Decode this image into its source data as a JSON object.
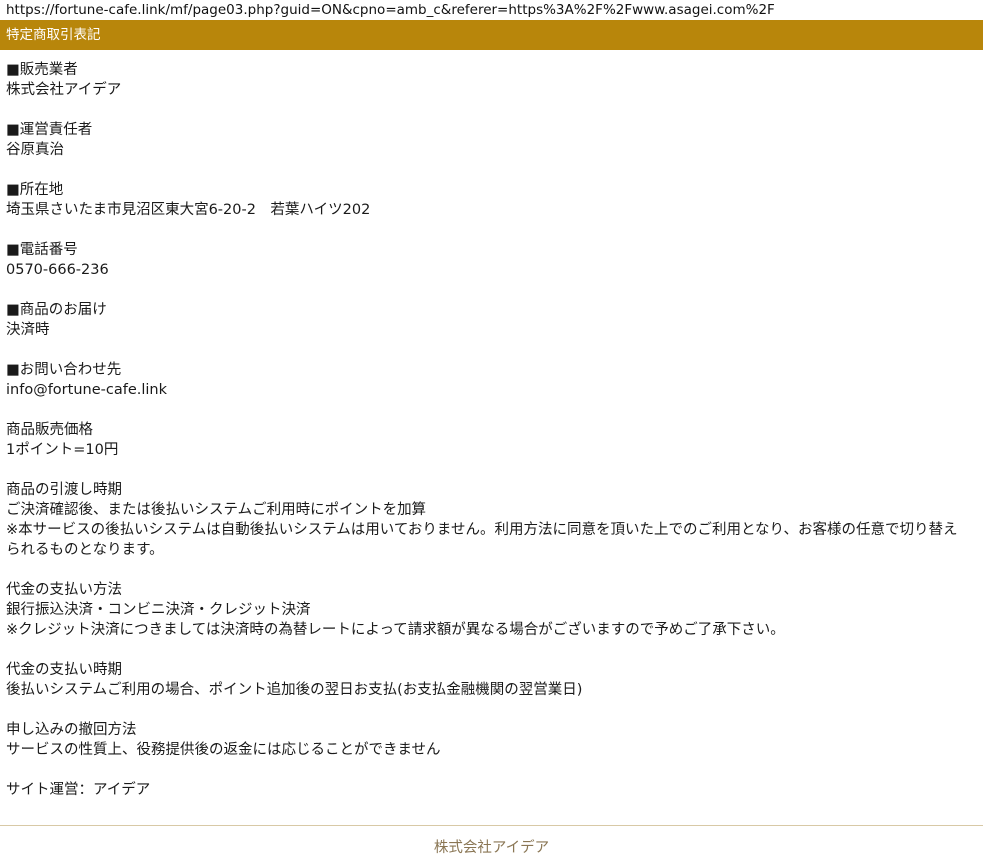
{
  "url": "https://fortune-cafe.link/mf/page03.php?guid=ON&cpno=amb_c&referer=https%3A%2F%2Fwww.asagei.com%2F",
  "header": {
    "title": "特定商取引表記"
  },
  "sections": [
    {
      "label": "■販売業者",
      "value": "株式会社アイデア"
    },
    {
      "label": "■運営責任者",
      "value": "谷原真治"
    },
    {
      "label": "■所在地",
      "value": "埼玉県さいたま市見沼区東大宮6-20-2　若葉ハイツ202"
    },
    {
      "label": "■電話番号",
      "value": "0570-666-236"
    },
    {
      "label": "■商品のお届け",
      "value": "決済時"
    },
    {
      "label": "■お問い合わせ先",
      "value": "info@fortune-cafe.link"
    },
    {
      "label": "商品販売価格",
      "value": "1ポイント=10円"
    },
    {
      "label": "商品の引渡し時期",
      "value": "ご決済確認後、または後払いシステムご利用時にポイントを加算",
      "note": "※本サービスの後払いシステムは自動後払いシステムは用いておりません。利用方法に同意を頂いた上でのご利用となり、お客様の任意で切り替えられるものとなります。"
    },
    {
      "label": "代金の支払い方法",
      "value": "銀行振込決済・コンビニ決済・クレジット決済",
      "note": "※クレジット決済につきましては決済時の為替レートによって請求額が異なる場合がございますので予めご了承下さい。"
    },
    {
      "label": "代金の支払い時期",
      "value": "後払いシステムご利用の場合、ポイント追加後の翌日お支払(お支払金融機関の翌営業日)"
    },
    {
      "label": "申し込みの撤回方法",
      "value": "サービスの性質上、役務提供後の返金には応じることができません"
    }
  ],
  "site_operator": "サイト運営：アイデア",
  "footer": {
    "company": "株式会社アイデア"
  }
}
